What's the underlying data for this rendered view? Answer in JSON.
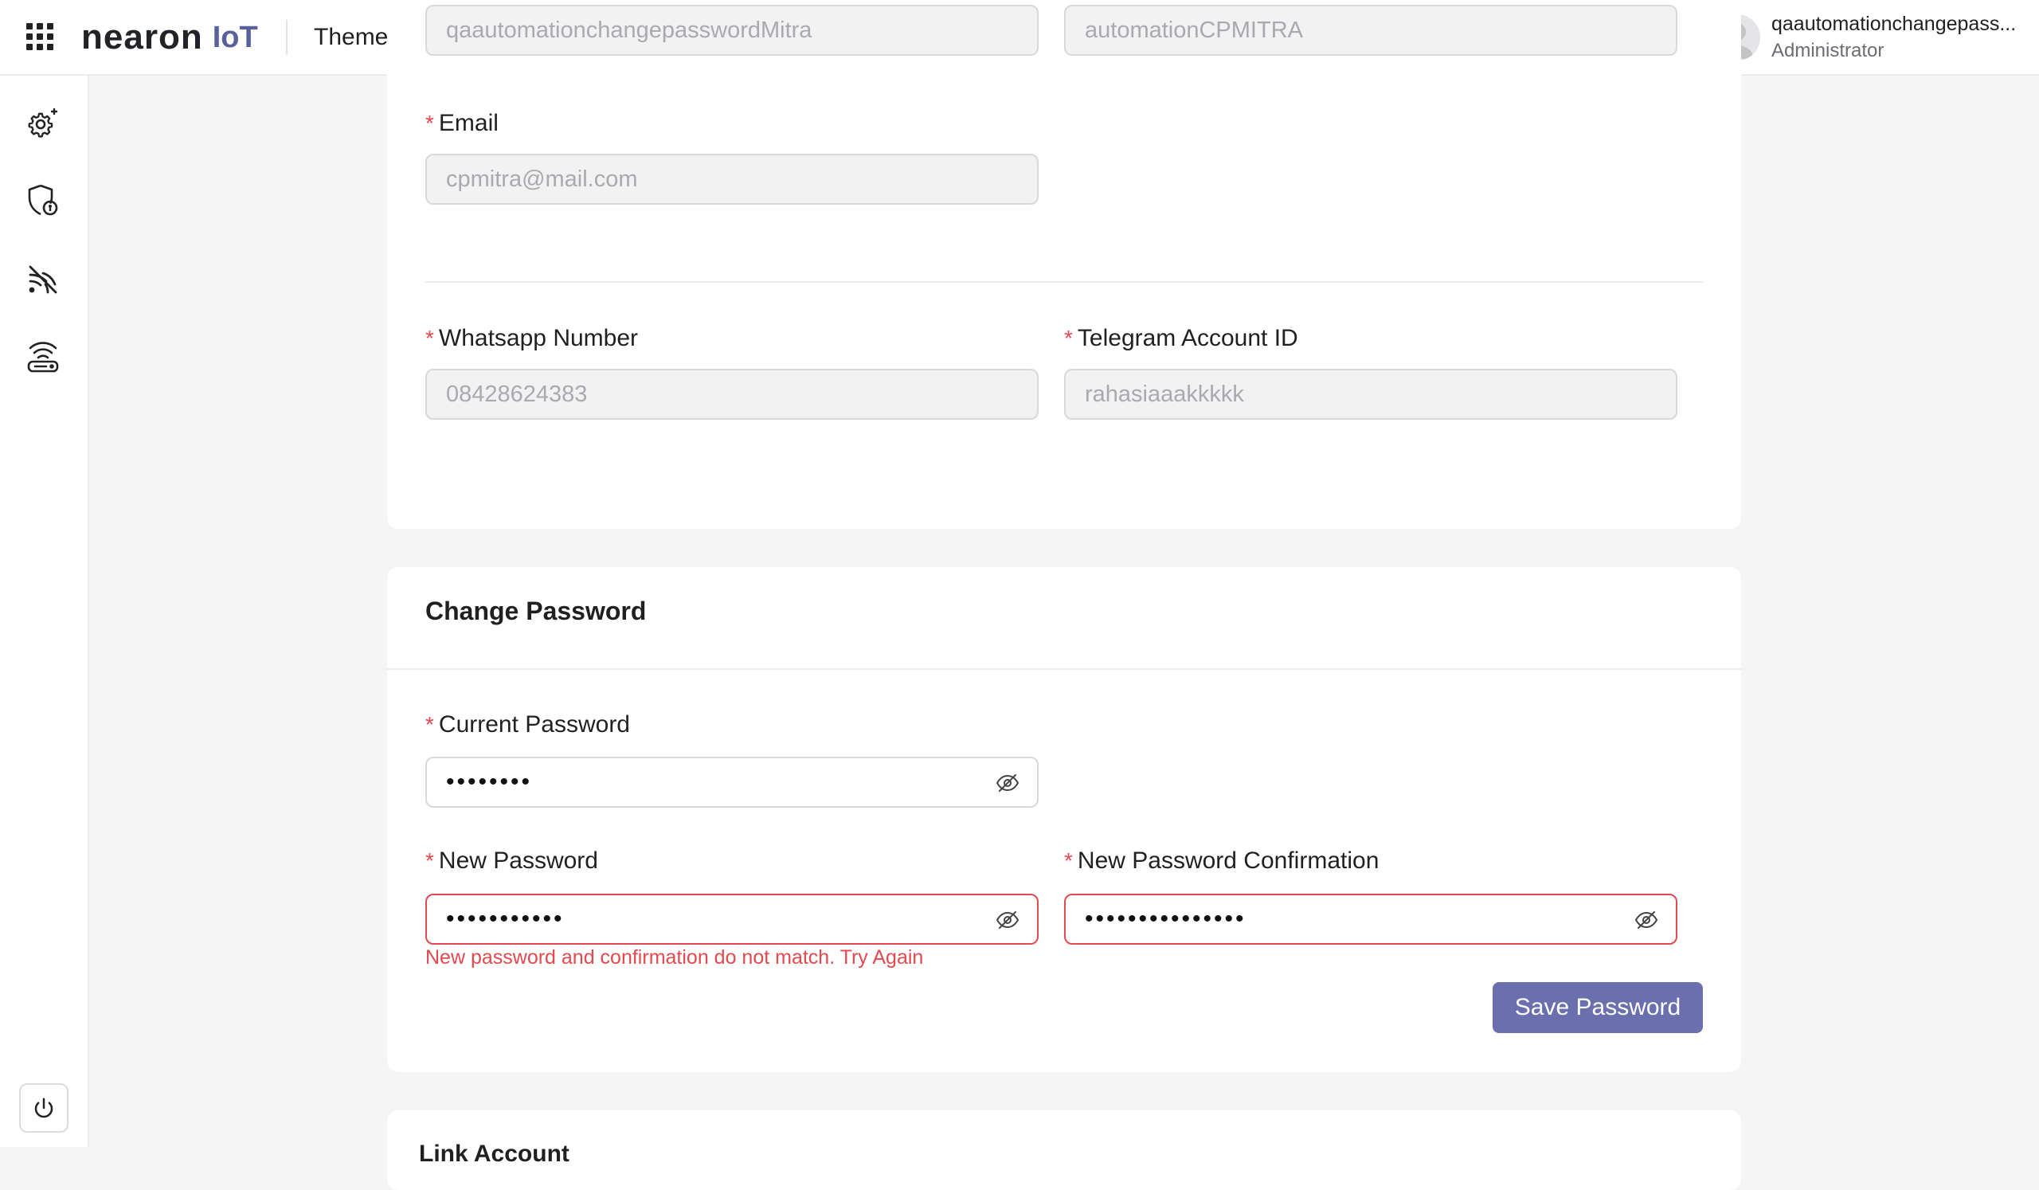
{
  "header": {
    "logo_main": "nearon",
    "logo_sub": "IoT",
    "theme_label": "Theme",
    "user_name": "qaautomationchangepass...",
    "user_role": "Administrator"
  },
  "sidebar": {
    "items": [
      {
        "icon": "settings-sparkle-icon"
      },
      {
        "icon": "shield-lock-icon"
      },
      {
        "icon": "signal-slash-icon"
      },
      {
        "icon": "router-wifi-icon"
      }
    ],
    "power_icon": "power-icon"
  },
  "profile": {
    "username_value": "qaautomationchangepasswordMitra",
    "name_value": "automationCPMITRA",
    "email_label": "Email",
    "email_value": "cpmitra@mail.com",
    "whatsapp_label": "Whatsapp Number",
    "whatsapp_value": "08428624383",
    "telegram_label": "Telegram Account ID",
    "telegram_value": "rahasiaaakkkkk"
  },
  "change_password": {
    "title": "Change Password",
    "current_label": "Current Password",
    "current_value": "••••••••",
    "new_label": "New Password",
    "new_value": "•••••••••••",
    "confirm_label": "New Password Confirmation",
    "confirm_value": "•••••••••••••••",
    "error_message": "New password and confirmation do not match. Try Again",
    "save_label": "Save Password"
  },
  "next_section": {
    "title": "Link Account"
  },
  "colors": {
    "accent": "#6b6fae",
    "logo_accent": "#5a5f9e",
    "error": "#e5484d",
    "toggle_bg": "#3b3e55"
  }
}
